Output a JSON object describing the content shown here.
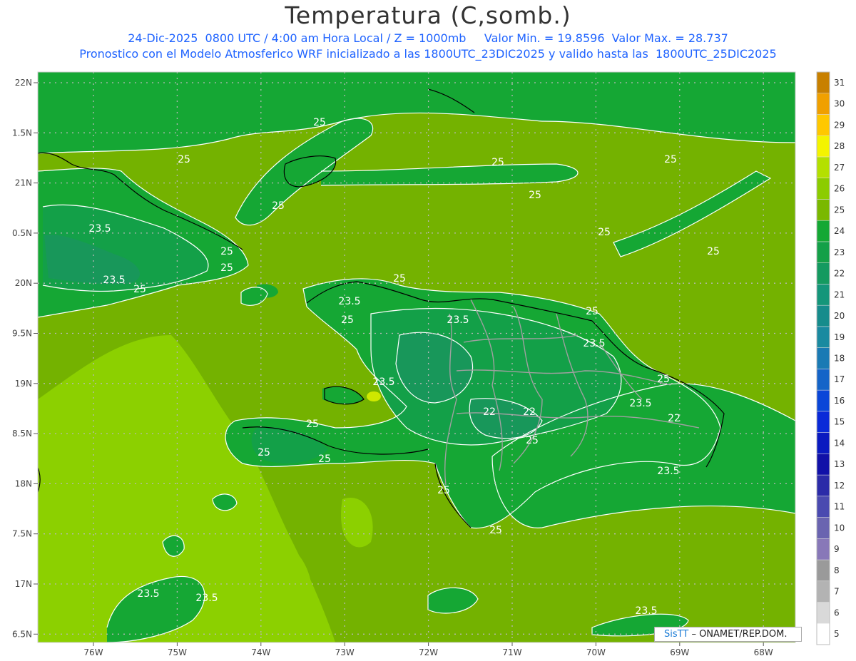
{
  "title": "Temperatura (C,somb.)",
  "subtitle_line1": "24-Dic-2025  0800 UTC / 4:00 am Hora Local / Z = 1000mb     Valor Min. = 19.8596  Valor Max. = 28.737",
  "subtitle_line2": "Pronostico con el Modelo Atmosferico WRF inicializado a las 1800UTC_23DIC2025 y valido hasta las  1800UTC_25DIC2025",
  "credit_brand": "SisTT",
  "credit_text": "– ONAMET/REP.DOM.",
  "map": {
    "lat_labels": [
      "22N",
      "1.5N",
      "21N",
      "0.5N",
      "20N",
      "9.5N",
      "19N",
      "8.5N",
      "18N",
      "7.5N",
      "17N",
      "6.5N"
    ],
    "lon_labels": [
      "76W",
      "75W",
      "74W",
      "73W",
      "72W",
      "71W",
      "70W",
      "69W",
      "68W"
    ],
    "contour_labels": [
      "25",
      "25",
      "25",
      "25",
      "25",
      "25",
      "25",
      "25",
      "25",
      "25",
      "25",
      "25",
      "25",
      "25",
      "25",
      "25",
      "25",
      "25",
      "25",
      "25",
      "25",
      "23.5",
      "23.5",
      "23.5",
      "23.5",
      "23.5",
      "23.5",
      "23.5",
      "23.5",
      "23.5",
      "23.5",
      "23.5",
      "22",
      "22",
      "22"
    ]
  },
  "colorbar": {
    "levels": [
      "5",
      "6",
      "7",
      "8",
      "9",
      "10",
      "11",
      "12",
      "13",
      "14",
      "15",
      "16",
      "17",
      "18",
      "19",
      "20",
      "21",
      "22",
      "23",
      "24",
      "25",
      "26",
      "27",
      "28",
      "29",
      "30",
      "31"
    ],
    "colors": [
      "#ffffff",
      "#d9d9d9",
      "#b3b3b3",
      "#9a9a9a",
      "#8878b8",
      "#6a64b0",
      "#4a4ab0",
      "#2b2ba8",
      "#1111a8",
      "#0a1ac0",
      "#0a2ad8",
      "#0a46d8",
      "#1464c8",
      "#1a7ab4",
      "#1a8aa0",
      "#168c8c",
      "#14967a",
      "#149a60",
      "#14a048",
      "#14a834",
      "#7ab800",
      "#8ccc00",
      "#b4e000",
      "#f4f400",
      "#ffc800",
      "#f0a000",
      "#c88000"
    ]
  },
  "colors": {
    "sea_25_26": "#74b200",
    "sea_26_27": "#8cd000",
    "land_24_25": "#15a734",
    "land_23_24": "#13a048",
    "land_22_23": "#18975a",
    "hot_spot": "#cfe800",
    "title_text": "#333333",
    "subtitle_text": "#1f63ff"
  }
}
